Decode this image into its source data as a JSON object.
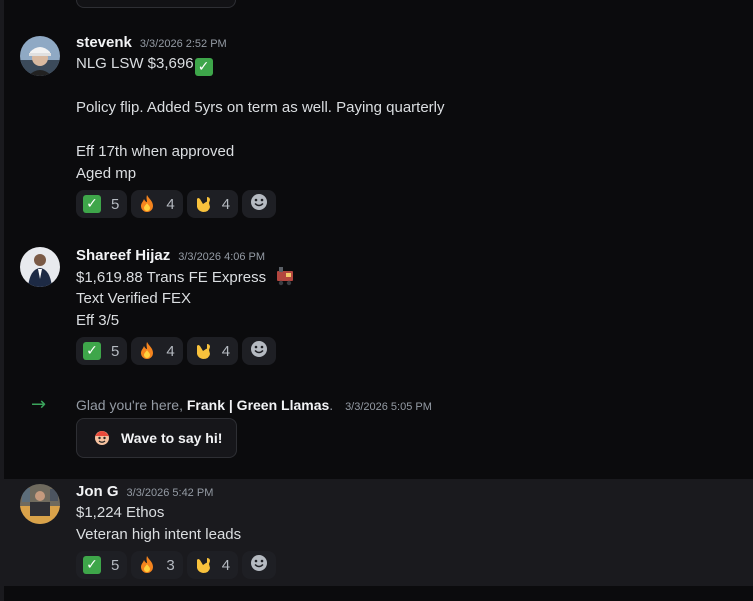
{
  "messages": [
    {
      "username": "stevenk",
      "timestamp": "3/3/2026 2:52 PM",
      "line1": "NLG LSW $3,696",
      "line2": "Policy flip. Added 5yrs on term as well. Paying quarterly",
      "line3": "Eff 17th when approved",
      "line4": "Aged mp",
      "reactions": [
        {
          "emoji": "check-mark-icon",
          "count": "5"
        },
        {
          "emoji": "fire-icon",
          "count": "4"
        },
        {
          "emoji": "call-me-hand-icon",
          "count": "4"
        }
      ]
    },
    {
      "username": "Shareef Hijaz",
      "timestamp": "3/3/2026 4:06 PM",
      "line1": "$1,619.88 Trans FE Express",
      "line2": "Text Verified FEX",
      "line3": "Eff 3/5",
      "reactions": [
        {
          "emoji": "check-mark-icon",
          "count": "5"
        },
        {
          "emoji": "fire-icon",
          "count": "4"
        },
        {
          "emoji": "call-me-hand-icon",
          "count": "4"
        }
      ]
    },
    {
      "username": "Jon G",
      "timestamp": "3/3/2026 5:42 PM",
      "line1": "$1,224 Ethos",
      "line2": "Veteran high intent leads",
      "reactions": [
        {
          "emoji": "check-mark-icon",
          "count": "5"
        },
        {
          "emoji": "fire-icon",
          "count": "3"
        },
        {
          "emoji": "call-me-hand-icon",
          "count": "4"
        }
      ]
    }
  ],
  "system": {
    "prefix": "Glad you're here, ",
    "name": "Frank | Green Llamas",
    "suffix": ".",
    "timestamp": "3/3/2026 5:05 PM",
    "wave_label": "Wave to say hi!"
  },
  "colors": {
    "background": "#0b0b0d",
    "highlight": "#1a1a1e",
    "reaction_bg": "#1e1f24",
    "join_arrow": "#3ba55c",
    "check": "#3ea64a"
  }
}
